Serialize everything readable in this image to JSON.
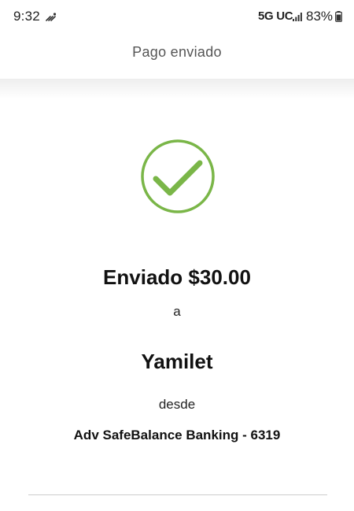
{
  "status_bar": {
    "time": "9:32",
    "network": "5G UC",
    "battery": "83%",
    "icons": [
      "notification-icon",
      "signal-icon",
      "battery-icon"
    ]
  },
  "header": {
    "title": "Pago enviado"
  },
  "confirmation": {
    "icon": "check-circle-icon",
    "accent_color": "#7ab648",
    "sent_text": "Enviado $30.00",
    "to_label": "a",
    "recipient": "Yamilet",
    "from_label": "desde",
    "account": "Adv SafeBalance Banking - 6319"
  }
}
